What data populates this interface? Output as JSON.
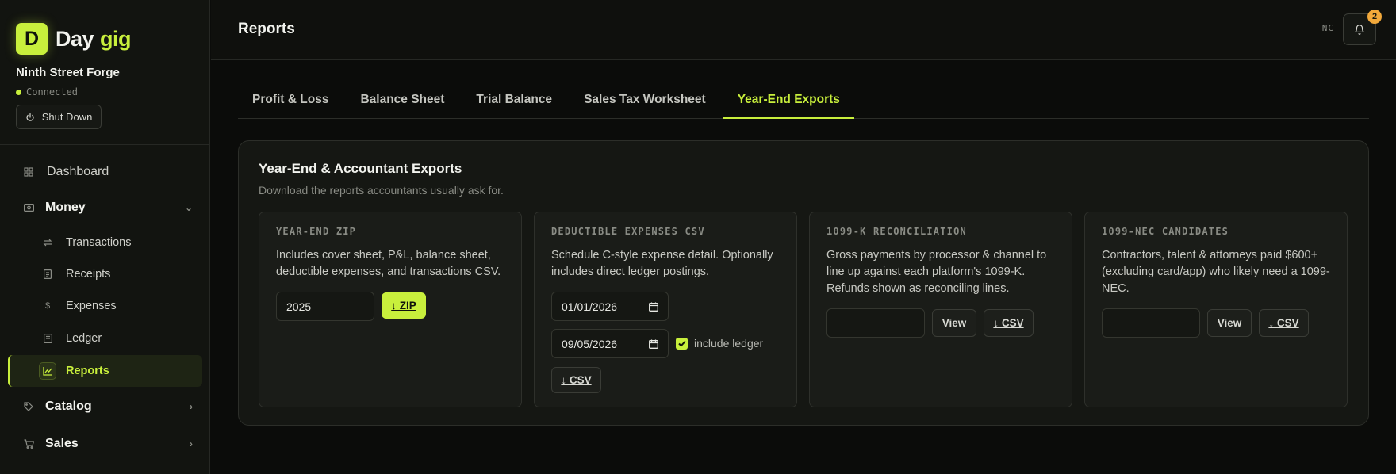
{
  "brand": {
    "logo_letter": "D",
    "name_part1": "Day",
    "name_part2": "gig",
    "accent_color": "#c8ef3c"
  },
  "workspace": {
    "name": "Ninth Street Forge",
    "status": "Connected",
    "shutdown_label": "Shut Down"
  },
  "nav": {
    "dashboard": {
      "label": "Dashboard",
      "icon": "grid-icon"
    },
    "money": {
      "label": "Money",
      "icon": "cash-icon",
      "expanded": true,
      "items": [
        {
          "label": "Transactions",
          "icon": "arrows-swap-icon"
        },
        {
          "label": "Receipts",
          "icon": "receipt-icon"
        },
        {
          "label": "Expenses",
          "icon": "dollar-icon"
        },
        {
          "label": "Ledger",
          "icon": "book-icon"
        },
        {
          "label": "Reports",
          "icon": "chart-icon",
          "active": true
        }
      ]
    },
    "catalog": {
      "label": "Catalog",
      "icon": "tag-icon"
    },
    "sales": {
      "label": "Sales",
      "icon": "cart-icon"
    }
  },
  "header": {
    "title": "Reports",
    "user_initials": "NC",
    "notification_count": "2"
  },
  "tabs": [
    {
      "label": "Profit & Loss"
    },
    {
      "label": "Balance Sheet"
    },
    {
      "label": "Trial Balance"
    },
    {
      "label": "Sales Tax Worksheet"
    },
    {
      "label": "Year-End Exports",
      "active": true
    }
  ],
  "panel": {
    "title": "Year-End & Accountant Exports",
    "description": "Download the reports accountants usually ask for.",
    "cards": {
      "year_end_zip": {
        "label": "YEAR-END ZIP",
        "body": "Includes cover sheet, P&L, balance sheet, deductible expenses, and transactions CSV.",
        "year_value": "2025",
        "button": "↓ ZIP"
      },
      "deductible": {
        "label": "DEDUCTIBLE EXPENSES CSV",
        "body": "Schedule C-style expense detail. Optionally includes direct ledger postings.",
        "start_date": "01/01/2026",
        "end_date": "09/05/2026",
        "include_ledger_label": "include ledger",
        "include_ledger_checked": true,
        "button": "↓ CSV"
      },
      "k1099": {
        "label": "1099-K RECONCILIATION",
        "body": "Gross payments by processor & channel to line up against each platform's 1099-K. Refunds shown as reconciling lines.",
        "input_value": "",
        "view_button": "View",
        "csv_button": "↓ CSV"
      },
      "nec1099": {
        "label": "1099-NEC CANDIDATES",
        "body": "Contractors, talent & attorneys paid $600+ (excluding card/app) who likely need a 1099-NEC.",
        "input_value": "",
        "view_button": "View",
        "csv_button": "↓ CSV"
      }
    }
  }
}
